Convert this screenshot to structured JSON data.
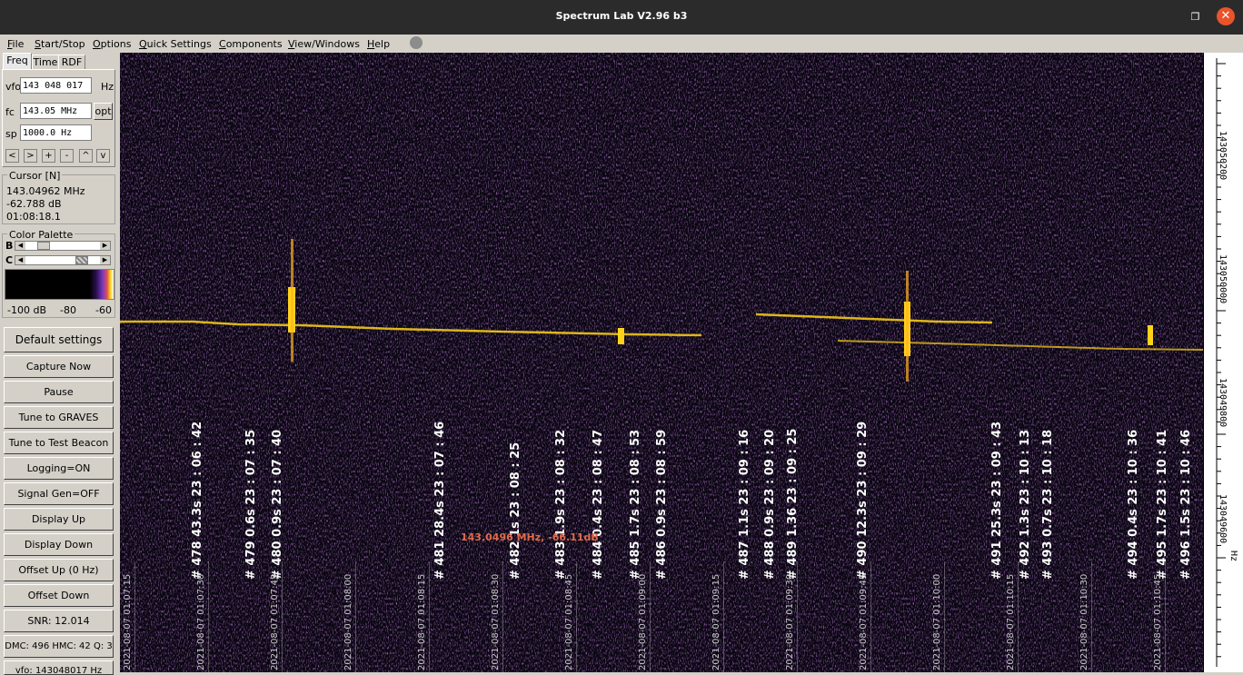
{
  "window": {
    "title": "Spectrum Lab V2.96 b3"
  },
  "menu": [
    "File",
    "Start/Stop",
    "Options",
    "Quick Settings",
    "Components",
    "View/Windows",
    "Help"
  ],
  "tabs": [
    "Freq",
    "Time",
    "RDF"
  ],
  "freq": {
    "vfo_label": "vfo",
    "vfo_value": "143 048 017",
    "vfo_unit": "Hz",
    "fc_label": "fc",
    "fc_value": "143.05 MHz",
    "opt_label": "opt",
    "sp_label": "sp",
    "sp_value": "1000.0 Hz",
    "nav_buttons": [
      "<",
      ">",
      "+",
      "-",
      "^",
      "v"
    ]
  },
  "cursor": {
    "title": "Cursor [N]",
    "freq": "143.04962 MHz",
    "level": "-62.788 dB",
    "time": "01:08:18.1"
  },
  "palette": {
    "title": "Color Palette",
    "b_label": "B",
    "c_label": "C",
    "scale": [
      "-100 dB",
      "-80",
      "-60"
    ]
  },
  "buttons": [
    "Default settings",
    "Capture Now",
    "Pause",
    "Tune to GRAVES",
    "Tune to Test Beacon",
    "Logging=ON",
    "Signal Gen=OFF",
    "Display Up",
    "Display Down",
    "Offset Up (0 Hz)",
    "Offset Down",
    "SNR: 12.014",
    "DMC: 496 HMC: 42 Q: 3",
    "vfo: 143048017 Hz"
  ],
  "waterfall": {
    "colors": {
      "background": "#0a0612",
      "signal": "#ffd21a",
      "noise_purple": "#5a2a8a"
    },
    "marker_text": "143.0496 MHz, -66.11dB",
    "annotations": [
      "# 478  43.3s  23 : 06 : 42",
      "# 479  0.6s  23 : 07 : 35",
      "# 480  0.9s  23 : 07 : 40",
      "# 481  28.4s  23 : 07 : 46",
      "# 482  1s  23 : 08 : 25",
      "# 483  1.9s  23 : 08 : 32",
      "# 484  0.4s  23 : 08 : 47",
      "# 485  1.7s  23 : 08 : 53",
      "# 486  0.9s  23 : 08 : 59",
      "# 487  1.1s  23 : 09 : 16",
      "# 488  0.9s  23 : 09 : 20",
      "# 489  1.36  23 : 09 : 25",
      "# 490  12.3s  23 : 09 : 29",
      "# 491  25.3s  23 : 09 : 43",
      "# 492  1.3s  23 : 10 : 13",
      "# 493  0.7s  23 : 10 : 18",
      "# 494  0.4s  23 : 10 : 36",
      "# 495  1.7s  23 : 10 : 41",
      "# 496  1.5s  23 : 10 : 46"
    ],
    "timestamps": [
      "2021-08-07 01:07:15",
      "2021-08-07 01:07:30",
      "2021-08-07 01:07:45",
      "2021-08-07 01:08:00",
      "2021-08-07 01:08:15",
      "2021-08-07 01:08:30",
      "2021-08-07 01:08:45",
      "2021-08-07 01:09:00",
      "2021-08-07 01:09:15",
      "2021-08-07 01:09:30",
      "2021-08-07 01:09:45",
      "2021-08-07 01:10:00",
      "2021-08-07 01:10:15",
      "2021-08-07 01:10:30",
      "2021-08-07 01:10:45"
    ]
  },
  "freq_scale": {
    "labels": [
      "143050200",
      "143050000",
      "143049800",
      "143049600"
    ],
    "unit": "Hz"
  }
}
